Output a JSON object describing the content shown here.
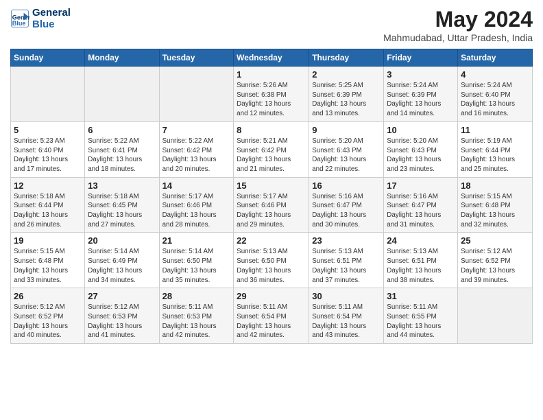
{
  "header": {
    "logo_line1": "General",
    "logo_line2": "Blue",
    "month_year": "May 2024",
    "location": "Mahmudabad, Uttar Pradesh, India"
  },
  "weekdays": [
    "Sunday",
    "Monday",
    "Tuesday",
    "Wednesday",
    "Thursday",
    "Friday",
    "Saturday"
  ],
  "weeks": [
    [
      {
        "day": "",
        "info": ""
      },
      {
        "day": "",
        "info": ""
      },
      {
        "day": "",
        "info": ""
      },
      {
        "day": "1",
        "info": "Sunrise: 5:26 AM\nSunset: 6:38 PM\nDaylight: 13 hours\nand 12 minutes."
      },
      {
        "day": "2",
        "info": "Sunrise: 5:25 AM\nSunset: 6:39 PM\nDaylight: 13 hours\nand 13 minutes."
      },
      {
        "day": "3",
        "info": "Sunrise: 5:24 AM\nSunset: 6:39 PM\nDaylight: 13 hours\nand 14 minutes."
      },
      {
        "day": "4",
        "info": "Sunrise: 5:24 AM\nSunset: 6:40 PM\nDaylight: 13 hours\nand 16 minutes."
      }
    ],
    [
      {
        "day": "5",
        "info": "Sunrise: 5:23 AM\nSunset: 6:40 PM\nDaylight: 13 hours\nand 17 minutes."
      },
      {
        "day": "6",
        "info": "Sunrise: 5:22 AM\nSunset: 6:41 PM\nDaylight: 13 hours\nand 18 minutes."
      },
      {
        "day": "7",
        "info": "Sunrise: 5:22 AM\nSunset: 6:42 PM\nDaylight: 13 hours\nand 20 minutes."
      },
      {
        "day": "8",
        "info": "Sunrise: 5:21 AM\nSunset: 6:42 PM\nDaylight: 13 hours\nand 21 minutes."
      },
      {
        "day": "9",
        "info": "Sunrise: 5:20 AM\nSunset: 6:43 PM\nDaylight: 13 hours\nand 22 minutes."
      },
      {
        "day": "10",
        "info": "Sunrise: 5:20 AM\nSunset: 6:43 PM\nDaylight: 13 hours\nand 23 minutes."
      },
      {
        "day": "11",
        "info": "Sunrise: 5:19 AM\nSunset: 6:44 PM\nDaylight: 13 hours\nand 25 minutes."
      }
    ],
    [
      {
        "day": "12",
        "info": "Sunrise: 5:18 AM\nSunset: 6:44 PM\nDaylight: 13 hours\nand 26 minutes."
      },
      {
        "day": "13",
        "info": "Sunrise: 5:18 AM\nSunset: 6:45 PM\nDaylight: 13 hours\nand 27 minutes."
      },
      {
        "day": "14",
        "info": "Sunrise: 5:17 AM\nSunset: 6:46 PM\nDaylight: 13 hours\nand 28 minutes."
      },
      {
        "day": "15",
        "info": "Sunrise: 5:17 AM\nSunset: 6:46 PM\nDaylight: 13 hours\nand 29 minutes."
      },
      {
        "day": "16",
        "info": "Sunrise: 5:16 AM\nSunset: 6:47 PM\nDaylight: 13 hours\nand 30 minutes."
      },
      {
        "day": "17",
        "info": "Sunrise: 5:16 AM\nSunset: 6:47 PM\nDaylight: 13 hours\nand 31 minutes."
      },
      {
        "day": "18",
        "info": "Sunrise: 5:15 AM\nSunset: 6:48 PM\nDaylight: 13 hours\nand 32 minutes."
      }
    ],
    [
      {
        "day": "19",
        "info": "Sunrise: 5:15 AM\nSunset: 6:48 PM\nDaylight: 13 hours\nand 33 minutes."
      },
      {
        "day": "20",
        "info": "Sunrise: 5:14 AM\nSunset: 6:49 PM\nDaylight: 13 hours\nand 34 minutes."
      },
      {
        "day": "21",
        "info": "Sunrise: 5:14 AM\nSunset: 6:50 PM\nDaylight: 13 hours\nand 35 minutes."
      },
      {
        "day": "22",
        "info": "Sunrise: 5:13 AM\nSunset: 6:50 PM\nDaylight: 13 hours\nand 36 minutes."
      },
      {
        "day": "23",
        "info": "Sunrise: 5:13 AM\nSunset: 6:51 PM\nDaylight: 13 hours\nand 37 minutes."
      },
      {
        "day": "24",
        "info": "Sunrise: 5:13 AM\nSunset: 6:51 PM\nDaylight: 13 hours\nand 38 minutes."
      },
      {
        "day": "25",
        "info": "Sunrise: 5:12 AM\nSunset: 6:52 PM\nDaylight: 13 hours\nand 39 minutes."
      }
    ],
    [
      {
        "day": "26",
        "info": "Sunrise: 5:12 AM\nSunset: 6:52 PM\nDaylight: 13 hours\nand 40 minutes."
      },
      {
        "day": "27",
        "info": "Sunrise: 5:12 AM\nSunset: 6:53 PM\nDaylight: 13 hours\nand 41 minutes."
      },
      {
        "day": "28",
        "info": "Sunrise: 5:11 AM\nSunset: 6:53 PM\nDaylight: 13 hours\nand 42 minutes."
      },
      {
        "day": "29",
        "info": "Sunrise: 5:11 AM\nSunset: 6:54 PM\nDaylight: 13 hours\nand 42 minutes."
      },
      {
        "day": "30",
        "info": "Sunrise: 5:11 AM\nSunset: 6:54 PM\nDaylight: 13 hours\nand 43 minutes."
      },
      {
        "day": "31",
        "info": "Sunrise: 5:11 AM\nSunset: 6:55 PM\nDaylight: 13 hours\nand 44 minutes."
      },
      {
        "day": "",
        "info": ""
      }
    ]
  ]
}
